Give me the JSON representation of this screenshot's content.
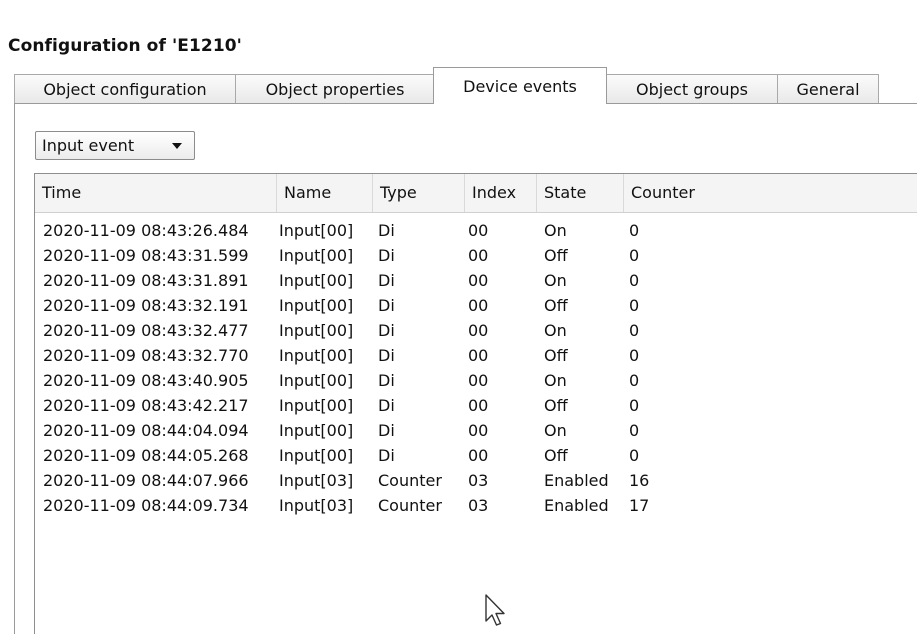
{
  "window": {
    "title": "Configuration of 'E1210'"
  },
  "tabs": [
    {
      "label": "Object configuration",
      "active": false
    },
    {
      "label": "Object properties",
      "active": false
    },
    {
      "label": "Device events",
      "active": true
    },
    {
      "label": "Object groups",
      "active": false
    },
    {
      "label": "General",
      "active": false
    }
  ],
  "event_filter": {
    "selected": "Input event"
  },
  "table": {
    "columns": [
      "Time",
      "Name",
      "Type",
      "Index",
      "State",
      "Counter"
    ],
    "rows": [
      [
        "2020-11-09 08:43:26.484",
        "Input[00]",
        "Di",
        "00",
        "On",
        "0"
      ],
      [
        "2020-11-09 08:43:31.599",
        "Input[00]",
        "Di",
        "00",
        "Off",
        "0"
      ],
      [
        "2020-11-09 08:43:31.891",
        "Input[00]",
        "Di",
        "00",
        "On",
        "0"
      ],
      [
        "2020-11-09 08:43:32.191",
        "Input[00]",
        "Di",
        "00",
        "Off",
        "0"
      ],
      [
        "2020-11-09 08:43:32.477",
        "Input[00]",
        "Di",
        "00",
        "On",
        "0"
      ],
      [
        "2020-11-09 08:43:32.770",
        "Input[00]",
        "Di",
        "00",
        "Off",
        "0"
      ],
      [
        "2020-11-09 08:43:40.905",
        "Input[00]",
        "Di",
        "00",
        "On",
        "0"
      ],
      [
        "2020-11-09 08:43:42.217",
        "Input[00]",
        "Di",
        "00",
        "Off",
        "0"
      ],
      [
        "2020-11-09 08:44:04.094",
        "Input[00]",
        "Di",
        "00",
        "On",
        "0"
      ],
      [
        "2020-11-09 08:44:05.268",
        "Input[00]",
        "Di",
        "00",
        "Off",
        "0"
      ],
      [
        "2020-11-09 08:44:07.966",
        "Input[03]",
        "Counter",
        "03",
        "Enabled",
        "16"
      ],
      [
        "2020-11-09 08:44:09.734",
        "Input[03]",
        "Counter",
        "03",
        "Enabled",
        "17"
      ]
    ]
  }
}
